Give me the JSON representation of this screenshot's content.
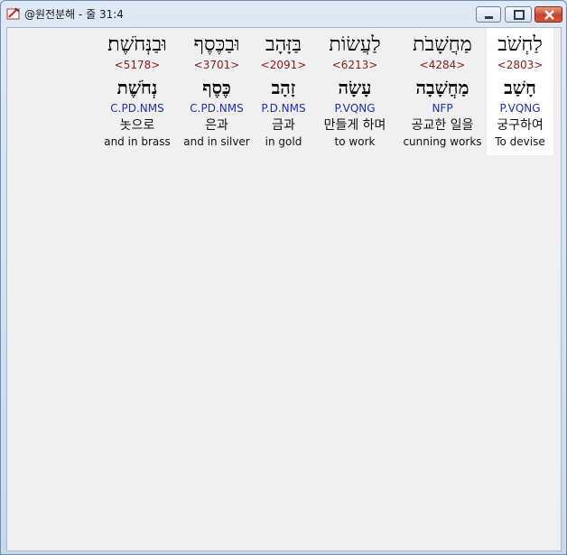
{
  "window": {
    "title": "@원전분해 - 줄 31:4"
  },
  "columns": [
    {
      "id": "c1",
      "hebrew": "וּבַנְּחֹשֶׁת׃",
      "strong": "<5178>",
      "root": "נְחֹשֶׁת",
      "morph": "C.PD.NMS",
      "korean": "놋으로",
      "english": "and in brass"
    },
    {
      "id": "c2",
      "hebrew": "וּבַכֶּסֶף",
      "strong": "<3701>",
      "root": "כֶּסֶף",
      "morph": "C.PD.NMS",
      "korean": "은과",
      "english": "and in silver"
    },
    {
      "id": "c3",
      "hebrew": "בַּזָּהָב",
      "strong": "<2091>",
      "root": "זָהָב",
      "morph": "P.D.NMS",
      "korean": "금과",
      "english": "in gold"
    },
    {
      "id": "c4",
      "hebrew": "לַעֲשׂוֹת",
      "strong": "<6213>",
      "root": "עָשָׂה",
      "morph": "P.VQNG",
      "korean": "만들게 하며",
      "english": "to work"
    },
    {
      "id": "c5",
      "hebrew": "מַחֲשָׁבֹת",
      "strong": "<4284>",
      "root": "מַחֲשָׁבָה",
      "morph": "NFP",
      "korean": "공교한 일을",
      "english": "cunning works"
    },
    {
      "id": "c6",
      "hebrew": "לַחְשֹׁב",
      "strong": "<2803>",
      "root": "חָשַׁב",
      "morph": "P.VQNG",
      "korean": "궁구하여",
      "english": "To devise"
    }
  ],
  "colors": {
    "strong": "#8b1a1a",
    "morph": "#1d2fb3",
    "selected_bg": "#ffffff",
    "client_bg": "#f0f0f0"
  }
}
